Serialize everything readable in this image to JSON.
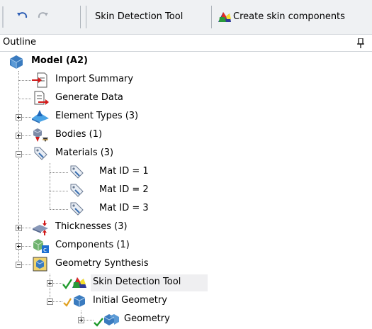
{
  "toolbar": {
    "undo_icon": "undo-icon",
    "redo_icon": "redo-icon",
    "skin_detection_label": "Skin Detection Tool",
    "create_skin_label": "Create skin components"
  },
  "outline": {
    "title": "Outline",
    "pin_icon": "pin-icon"
  },
  "tree": {
    "root": {
      "label": "Model (A2)",
      "icon": "model-icon"
    },
    "items": [
      {
        "label": "Import Summary",
        "icon": "import-summary-icon"
      },
      {
        "label": "Generate Data",
        "icon": "generate-data-icon"
      },
      {
        "label": "Element Types (3)",
        "icon": "element-types-icon",
        "expanded": false
      },
      {
        "label": "Bodies (1)",
        "icon": "bodies-icon",
        "expanded": false
      },
      {
        "label": "Materials (3)",
        "icon": "materials-icon",
        "expanded": true
      },
      {
        "label": "Mat ID = 1",
        "icon": "material-icon"
      },
      {
        "label": "Mat ID = 2",
        "icon": "material-icon"
      },
      {
        "label": "Mat ID = 3",
        "icon": "material-icon"
      },
      {
        "label": "Thicknesses (3)",
        "icon": "thicknesses-icon",
        "expanded": false
      },
      {
        "label": "Components (1)",
        "icon": "components-icon",
        "expanded": false
      },
      {
        "label": "Geometry Synthesis",
        "icon": "geometry-synthesis-icon",
        "expanded": true
      },
      {
        "label": "Skin Detection Tool",
        "icon": "skin-detection-icon",
        "expanded": false,
        "status": "ok"
      },
      {
        "label": "Initial Geometry",
        "icon": "initial-geometry-icon",
        "expanded": true,
        "status": "pending"
      },
      {
        "label": "Geometry",
        "icon": "geometry-icon",
        "expanded": false,
        "status": "ok"
      }
    ]
  }
}
